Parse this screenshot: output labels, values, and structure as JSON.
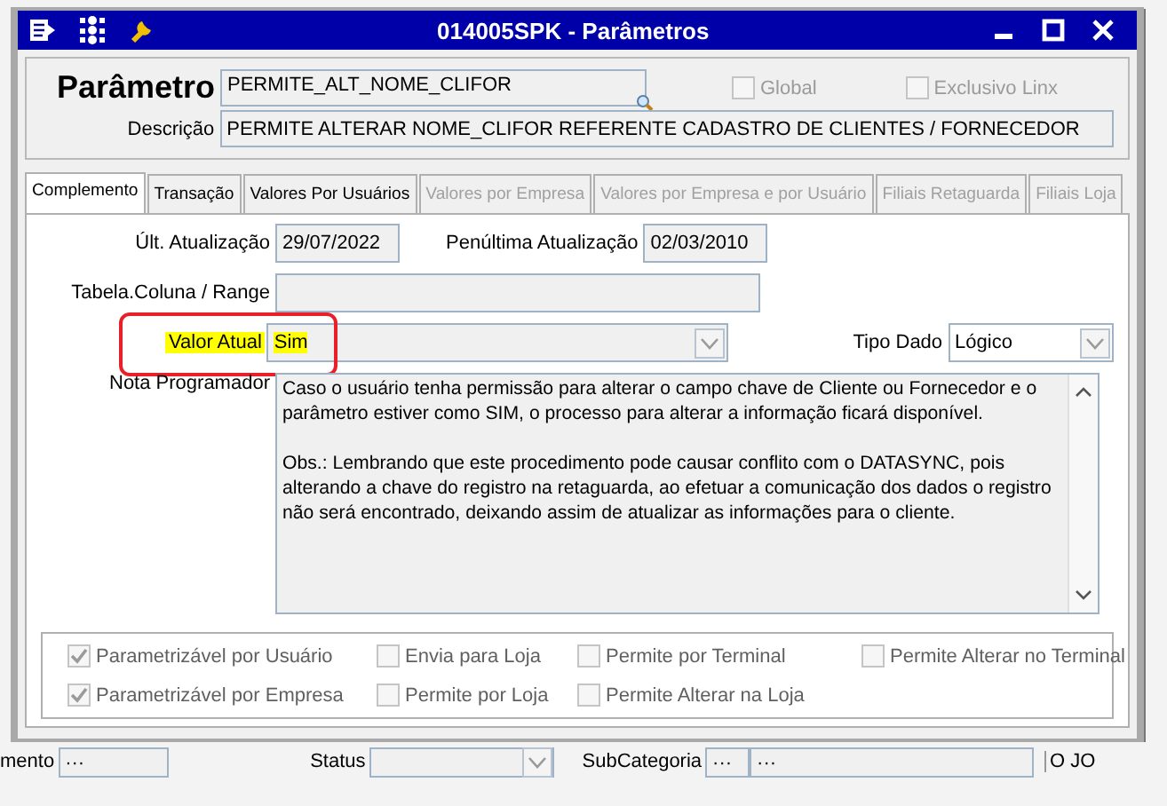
{
  "window": {
    "title": "014005SPK - Parâmetros"
  },
  "header": {
    "parametro_label": "Parâmetro",
    "parametro_value": "PERMITE_ALT_NOME_CLIFOR",
    "flags": [
      {
        "label": "Global",
        "checked": false
      },
      {
        "label": "Exclusivo Linx",
        "checked": false
      }
    ],
    "descricao_label": "Descrição",
    "descricao_value": "PERMITE ALTERAR NOME_CLIFOR REFERENTE CADASTRO DE CLIENTES / FORNECEDOR"
  },
  "tabs": [
    {
      "label": "Complemento",
      "selected": true,
      "disabled": false
    },
    {
      "label": "Transação",
      "selected": false,
      "disabled": false
    },
    {
      "label": "Valores Por Usuários",
      "selected": false,
      "disabled": false
    },
    {
      "label": "Valores por Empresa",
      "selected": false,
      "disabled": true
    },
    {
      "label": "Valores por Empresa e por Usuário",
      "selected": false,
      "disabled": true
    },
    {
      "label": "Filiais Retaguarda",
      "selected": false,
      "disabled": true
    },
    {
      "label": "Filiais Loja",
      "selected": false,
      "disabled": true
    }
  ],
  "fields": {
    "ult_label": "Últ. Atualização",
    "ult_value": "29/07/2022",
    "pen_label": "Penúltima Atualização",
    "pen_value": "02/03/2010",
    "tabela_label": "Tabela.Coluna / Range",
    "valor_label": "Valor Atual",
    "valor_value": "Sim",
    "valor_highlighted": true,
    "tipo_label": "Tipo Dado",
    "tipo_value": "Lógico",
    "nota_label": "Nota Programador",
    "nota_paragraphs": [
      "Caso o usuário tenha permissão para alterar o campo chave de Cliente ou Fornecedor e o parâmetro estiver como SIM, o processo para alterar a informação ficará disponível.",
      "Obs.: Lembrando que este procedimento pode causar conflito com o DATASYNC, pois alterando a chave do registro na retaguarda, ao efetuar a comunicação dos dados o registro não será encontrado, deixando assim de atualizar as informações para o cliente."
    ]
  },
  "options": [
    [
      {
        "label": "Parametrizável por Usuário",
        "checked": true
      },
      {
        "label": "Envia para Loja",
        "checked": false
      },
      {
        "label": "Permite por Terminal",
        "checked": false
      },
      {
        "label": "Permite Alterar no Terminal",
        "checked": false
      }
    ],
    [
      {
        "label": "Parametrizável por Empresa",
        "checked": true
      },
      {
        "label": "Permite por Loja",
        "checked": false
      },
      {
        "label": "Permite Alterar na Loja",
        "checked": false
      }
    ]
  ],
  "background": {
    "field1_label": "mento",
    "field1_value": "···",
    "status_label": "Status",
    "subcat_label": "SubCategoria",
    "subcat_code": "···",
    "subcat_value": "···",
    "edge_text": "O JO"
  }
}
